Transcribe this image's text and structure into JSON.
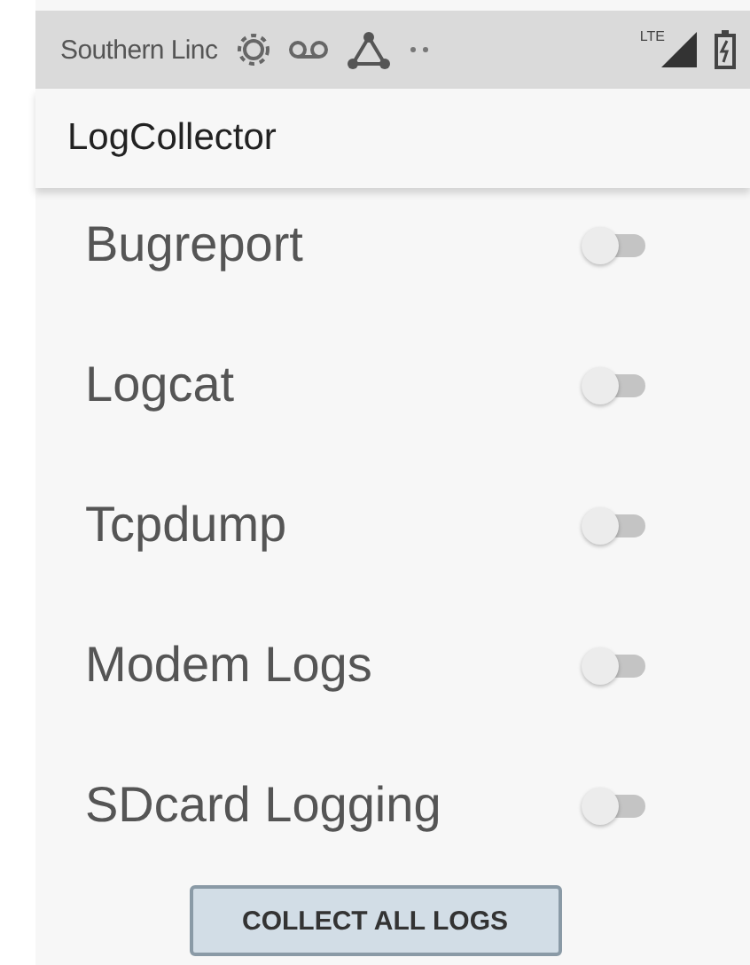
{
  "status_bar": {
    "carrier": "Southern Linc",
    "network": "LTE"
  },
  "app_bar": {
    "title": "LogCollector"
  },
  "settings": [
    {
      "label": "Bugreport",
      "on": false
    },
    {
      "label": "Logcat",
      "on": false
    },
    {
      "label": "Tcpdump",
      "on": false
    },
    {
      "label": "Modem Logs",
      "on": false
    },
    {
      "label": "SDcard Logging",
      "on": false
    }
  ],
  "button": {
    "label": "COLLECT ALL LOGS"
  }
}
